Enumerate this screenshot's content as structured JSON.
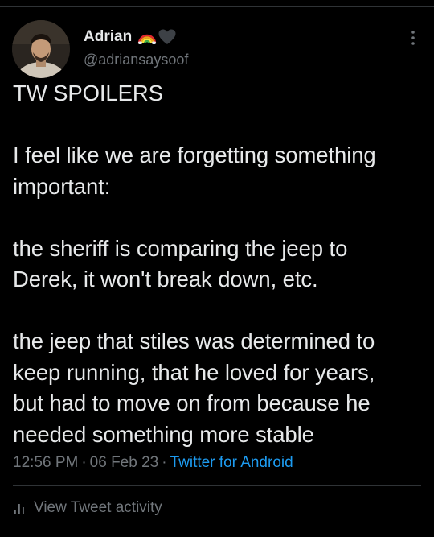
{
  "user": {
    "display_name": "Adrian",
    "handle": "@adriansaysoof",
    "avatar_icon": "profile-photo",
    "name_emojis": [
      "rainbow-icon",
      "black-heart-icon"
    ]
  },
  "menu": {
    "icon": "more-vertical-icon"
  },
  "tweet": {
    "line1": "TW SPOILERS",
    "p1_l1": "I feel like we are forgetting something",
    "p1_l2": "important:",
    "p2_l1": "the sheriff is comparing the jeep to",
    "p2_l2": "Derek, it won't break down, etc.",
    "p3_l1": "the jeep that stiles was determined to",
    "p3_l2": "keep running, that he loved for years,",
    "p3_l3": "but had to move on from because he",
    "p3_l4": "needed something more stable"
  },
  "meta": {
    "time": "12:56 PM",
    "date": "06 Feb 23",
    "separator": "·",
    "source": "Twitter for Android"
  },
  "activity": {
    "label": "View Tweet activity",
    "icon": "bar-chart-icon"
  },
  "colors": {
    "background": "#000000",
    "text": "#e7e9ea",
    "secondary": "#71767b",
    "link": "#1d9bf0",
    "divider": "#2f3336"
  }
}
